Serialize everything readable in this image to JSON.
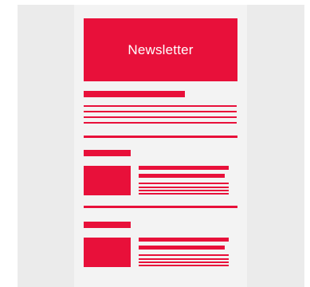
{
  "colors": {
    "accent": "#e8103a",
    "page_bg": "#f3f3f3",
    "backdrop": "#ebebeb"
  },
  "hero": {
    "title": "Newsletter"
  }
}
